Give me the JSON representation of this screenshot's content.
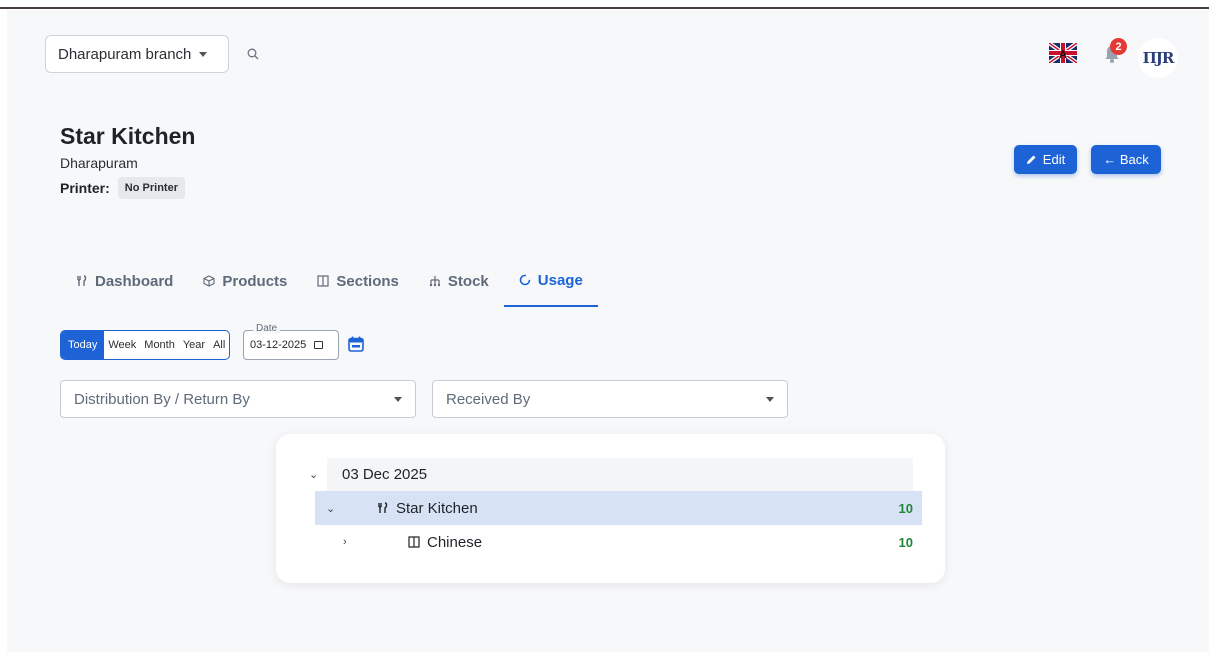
{
  "header": {
    "branch": "Dharapuram branch",
    "notification_count": "2",
    "avatar_text": "ΠJR"
  },
  "kitchen": {
    "title": "Star Kitchen",
    "location": "Dharapuram",
    "printer_label": "Printer:",
    "printer_value": "No Printer"
  },
  "actions": {
    "edit": "Edit",
    "back": "← Back"
  },
  "tabs": [
    {
      "label": "Dashboard",
      "icon": "utensils-icon"
    },
    {
      "label": "Products",
      "icon": "box-icon"
    },
    {
      "label": "Sections",
      "icon": "columns-icon"
    },
    {
      "label": "Stock",
      "icon": "sitemap-icon"
    },
    {
      "label": "Usage",
      "icon": "circle-icon",
      "active": true
    }
  ],
  "filters": {
    "periods": [
      "Today",
      "Week",
      "Month",
      "Year",
      "All"
    ],
    "active_period": "Today",
    "date_label": "Date",
    "date_value": "03-12-2025",
    "distribution_placeholder": "Distribution By / Return By",
    "received_placeholder": "Received By"
  },
  "tree": {
    "date": "03 Dec 2025",
    "kitchen": {
      "label": "Star Kitchen",
      "qty": "10"
    },
    "section": {
      "label": "Chinese",
      "qty": "10"
    }
  },
  "colors": {
    "accent": "#1e63d6",
    "qty": "#238636",
    "badge": "#e53935"
  }
}
